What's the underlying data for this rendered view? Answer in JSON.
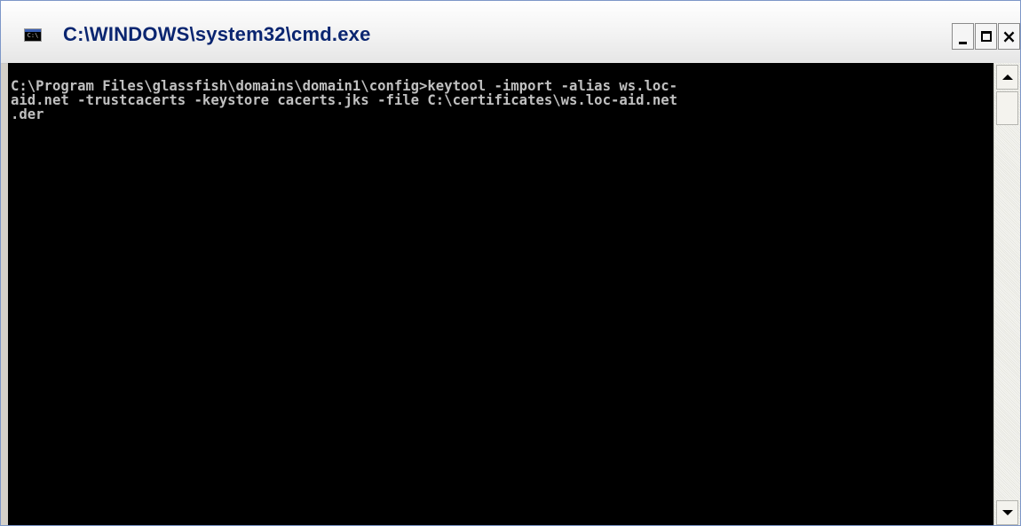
{
  "window": {
    "title": "C:\\WINDOWS\\system32\\cmd.exe",
    "icon": "cmd-icon",
    "icon_text": "C:\\",
    "controls": {
      "minimize": "minimize-icon",
      "maximize": "maximize-icon",
      "close_label": "×"
    }
  },
  "console": {
    "colors": {
      "background": "#000000",
      "text": "#c0c0c0"
    },
    "lines": [
      "C:\\Program Files\\glassfish\\domains\\domain1\\config>keytool -import -alias ws.loc-",
      "aid.net -trustcacerts -keystore cacerts.jks -file C:\\certificates\\ws.loc-aid.net",
      ".der"
    ]
  },
  "scrollbar": {
    "up_icon": "scroll-up-arrow-icon",
    "down_icon": "scroll-down-arrow-icon"
  }
}
